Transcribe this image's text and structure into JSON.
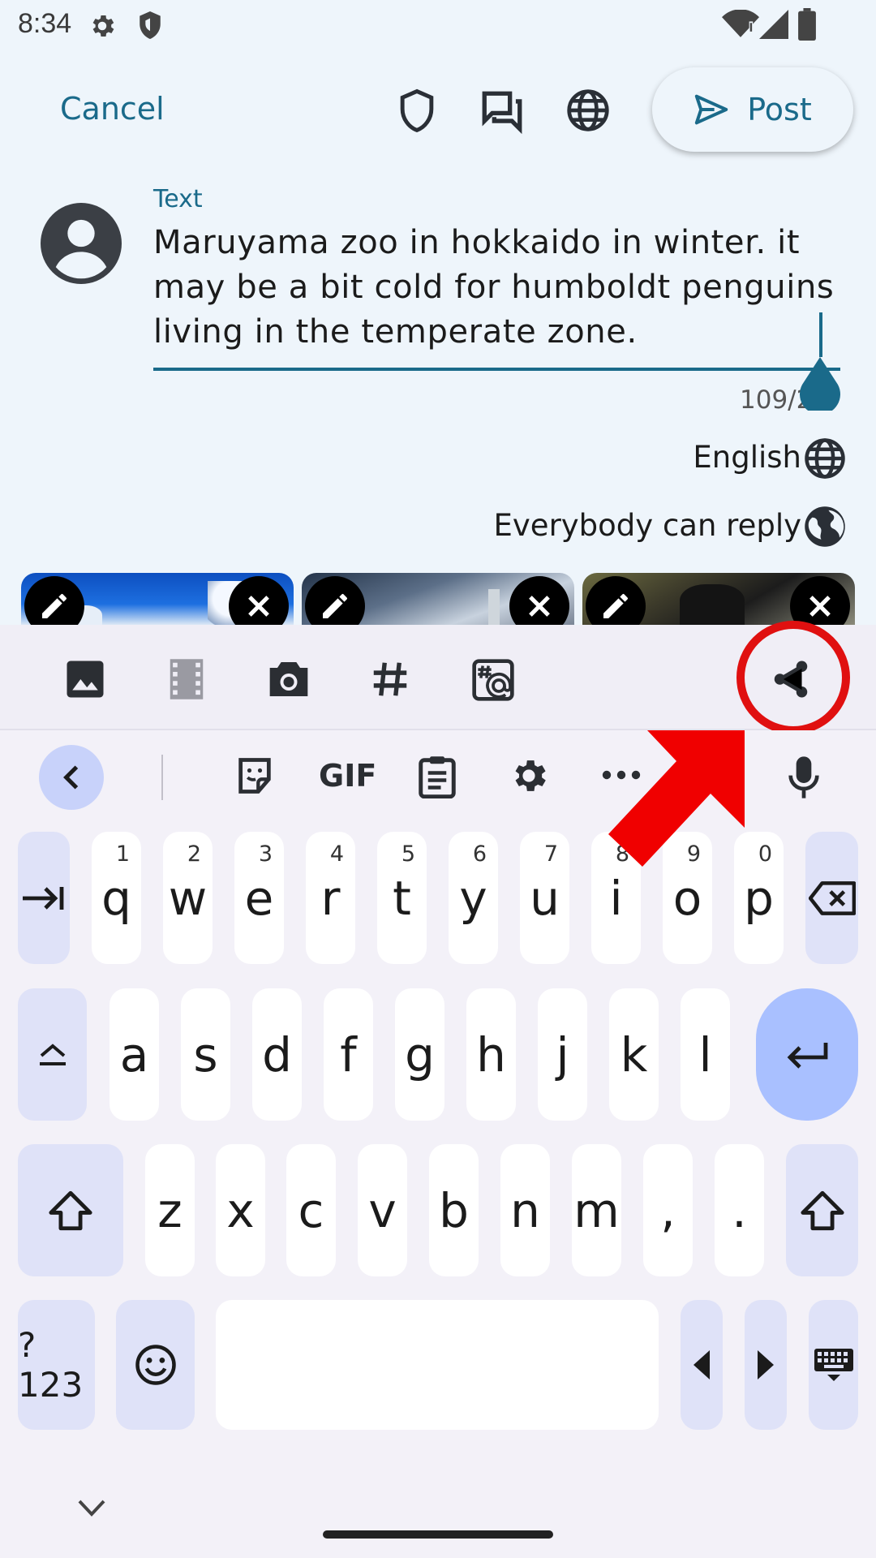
{
  "status_bar": {
    "time": "8:34"
  },
  "top_bar": {
    "cancel_label": "Cancel",
    "post_label": "Post"
  },
  "composer": {
    "field_label": "Text",
    "text": "Maruyama zoo in hokkaido in winter. it may be a bit cold for humboldt penguins living in the temperate zone.",
    "char_counter": "109/2",
    "language_label": "English",
    "reply_label": "Everybody can reply"
  },
  "keyboard": {
    "gif_label": "GIF",
    "row1": [
      {
        "key": "q",
        "hint": "1"
      },
      {
        "key": "w",
        "hint": "2"
      },
      {
        "key": "e",
        "hint": "3"
      },
      {
        "key": "r",
        "hint": "4"
      },
      {
        "key": "t",
        "hint": "5"
      },
      {
        "key": "y",
        "hint": "6"
      },
      {
        "key": "u",
        "hint": "7"
      },
      {
        "key": "i",
        "hint": "8"
      },
      {
        "key": "o",
        "hint": "9"
      },
      {
        "key": "p",
        "hint": "0"
      }
    ],
    "row2": [
      "a",
      "s",
      "d",
      "f",
      "g",
      "h",
      "j",
      "k",
      "l"
    ],
    "row3": [
      "z",
      "x",
      "c",
      "v",
      "b",
      "n",
      "m",
      ",",
      "."
    ],
    "symbols_label": "?123"
  },
  "colors": {
    "accent": "#1a6a8a",
    "highlight": "#e01010",
    "keyboard_mod": "#dfe2f8",
    "enter": "#a9c0ff"
  }
}
